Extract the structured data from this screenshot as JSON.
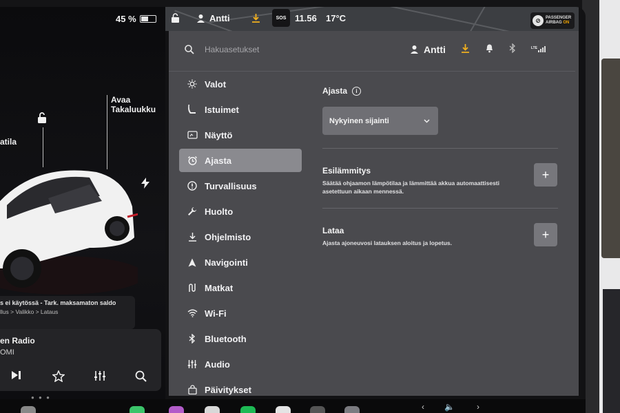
{
  "status": {
    "battery_percent": "45 %",
    "user": "Antti",
    "sos": "SOS",
    "time": "11.56",
    "temperature": "17°C",
    "airbag_line1": "PASSENGER",
    "airbag_line2": "AIRBAG",
    "airbag_state": "ON"
  },
  "car": {
    "label_open_trunk": "Avaa\nTakaluukku",
    "label_left_partial": "atila",
    "notice_line1": "s ei käytössä - Tark. maksamaton saldo",
    "notice_line2": "llus > Valikko > Lataus"
  },
  "media": {
    "title": "en Radio",
    "subtitle": "OMI"
  },
  "search": {
    "placeholder": "Hakuasetukset"
  },
  "header": {
    "user": "Antti",
    "lte": "LTE"
  },
  "menu": {
    "items": [
      {
        "label": "Valot",
        "icon": "sun-icon"
      },
      {
        "label": "Istuimet",
        "icon": "seat-icon"
      },
      {
        "label": "Näyttö",
        "icon": "display-icon"
      },
      {
        "label": "Ajasta",
        "icon": "alarm-clock-icon",
        "active": true
      },
      {
        "label": "Turvallisuus",
        "icon": "alert-circle-icon"
      },
      {
        "label": "Huolto",
        "icon": "wrench-icon"
      },
      {
        "label": "Ohjelmisto",
        "icon": "download-icon"
      },
      {
        "label": "Navigointi",
        "icon": "navigation-arrow-icon"
      },
      {
        "label": "Matkat",
        "icon": "trips-icon"
      },
      {
        "label": "Wi-Fi",
        "icon": "wifi-icon"
      },
      {
        "label": "Bluetooth",
        "icon": "bluetooth-icon"
      },
      {
        "label": "Audio",
        "icon": "sliders-icon"
      },
      {
        "label": "Päivitykset",
        "icon": "lock-bag-icon"
      }
    ]
  },
  "content": {
    "title": "Ajasta",
    "dropdown_value": "Nykyinen sijainti",
    "preheat": {
      "title": "Esilämmitys",
      "description": "Säätää ohjaamon lämpötilaa ja lämmittää akkua automaattisesti asetettuun aikaan mennessä."
    },
    "charge": {
      "title": "Lataa",
      "description": "Ajasta ajoneuvosi latauksen aloitus ja lopetus."
    }
  },
  "colors": {
    "accent_download": "#f2b01e",
    "panel_bg": "#4a4a4e",
    "active_item": "#8a8a8f"
  }
}
